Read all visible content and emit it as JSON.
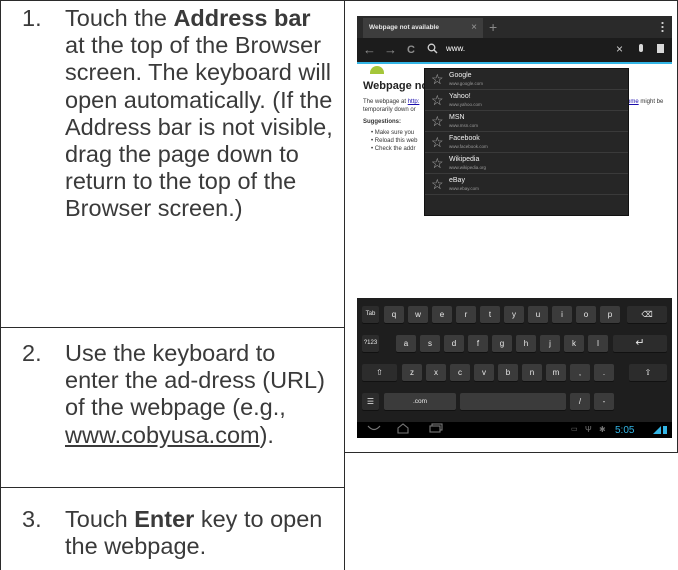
{
  "steps": [
    {
      "number": "1.",
      "parts": [
        {
          "t": "Touch the "
        },
        {
          "t": "Address bar",
          "b": true
        },
        {
          "t": " at the top of the Browser screen. The keyboard will open automatically. (If the Address bar is not visible, drag the page down to return to the top of the Browser screen.)"
        }
      ]
    },
    {
      "number": "2.",
      "parts": [
        {
          "t": "Use the keyboard to enter the ad-dress (URL) of the webpage (e.g., "
        },
        {
          "t": "www.cobyusa.com",
          "u": true
        },
        {
          "t": ")."
        }
      ]
    },
    {
      "number": "3.",
      "parts": [
        {
          "t": "Touch "
        },
        {
          "t": "Enter",
          "b": true
        },
        {
          "t": " key to open the webpage."
        }
      ]
    }
  ],
  "screenshot": {
    "tab_title": "Webpage not available",
    "tab_close": "×",
    "new_tab": "+",
    "nav": {
      "back": "←",
      "forward": "→",
      "reload": "C",
      "search": "🔍"
    },
    "url_value": "www.",
    "url_clear": "×",
    "page_heading": "Webpage not a",
    "body_text_pre": "The webpage at ",
    "body_link": "http:",
    "body_text_mid": "temporarily down or",
    "body_link_right": "ome",
    "body_text_right": " might be",
    "suggestions_title": "Suggestions:",
    "suggestions_list": [
      "Make sure you",
      "Reload this web",
      "Check the addr"
    ],
    "dropdown": [
      {
        "name": "Google",
        "url": "www.google.com"
      },
      {
        "name": "Yahoo!",
        "url": "www.yahoo.com"
      },
      {
        "name": "MSN",
        "url": "www.msn.com"
      },
      {
        "name": "Facebook",
        "url": "www.facebook.com"
      },
      {
        "name": "Wikipedia",
        "url": "www.wikipedia.org"
      },
      {
        "name": "eBay",
        "url": "www.ebay.com"
      }
    ],
    "keyboard": {
      "row1": [
        "Tab",
        "q",
        "w",
        "e",
        "r",
        "t",
        "y",
        "u",
        "i",
        "o",
        "p",
        "⌫"
      ],
      "row2": [
        "?123",
        "a",
        "s",
        "d",
        "f",
        "g",
        "h",
        "j",
        "k",
        "l",
        "↵"
      ],
      "row3": [
        "⇧",
        "z",
        "x",
        "c",
        "v",
        "b",
        "n",
        "m",
        ",",
        ".",
        "⇧"
      ],
      "row4": [
        "☰",
        ".com",
        "",
        "/",
        "-"
      ]
    },
    "clock": "5:05",
    "accent_color": "#33b5e5"
  }
}
